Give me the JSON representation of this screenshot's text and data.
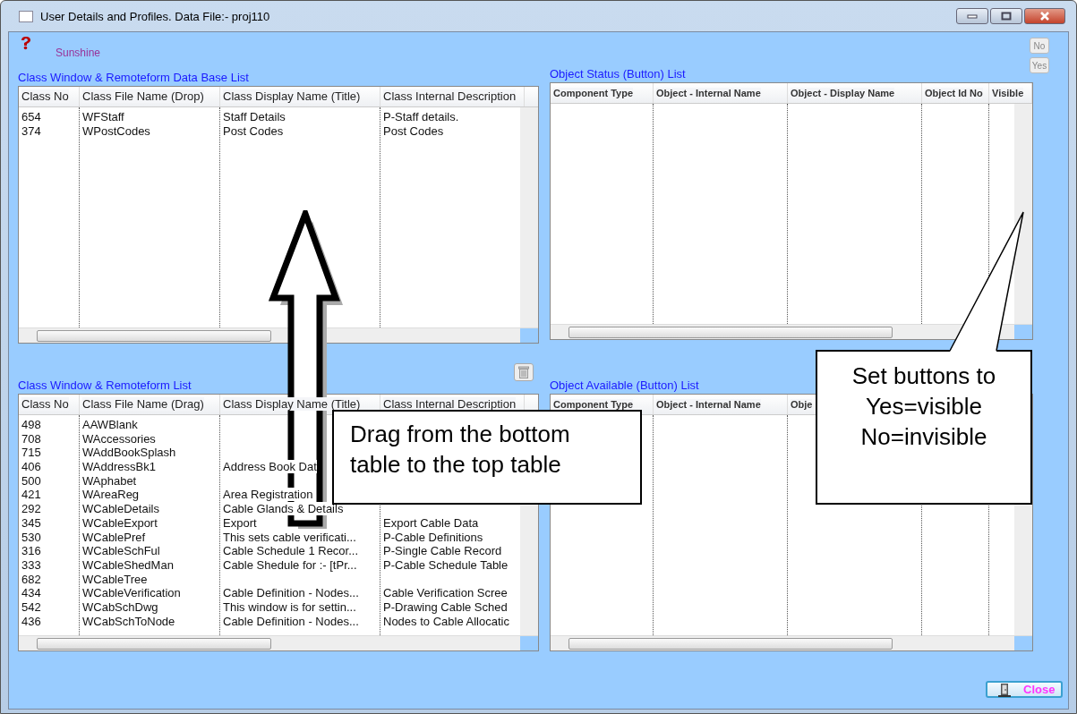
{
  "window": {
    "title": "User Details and Profiles. Data File:- proj110"
  },
  "user": "Sunshine",
  "buttons": [
    {
      "label": "No"
    },
    {
      "label": "Yes"
    }
  ],
  "class_db_list": {
    "title": "Class Window & Remoteform Data Base List",
    "columns": [
      "Class No",
      "Class File Name (Drop)",
      "Class Display Name (Title)",
      "Class Internal Description"
    ],
    "rows": [
      [
        "654",
        "WFStaff",
        "Staff Details",
        "P-Staff details."
      ],
      [
        "374",
        "WPostCodes",
        "Post Codes",
        "Post Codes"
      ]
    ]
  },
  "object_status_list": {
    "title": "Object Status (Button) List",
    "columns": [
      "Component Type",
      "Object - Internal Name",
      "Object - Display Name",
      "Object Id No",
      "Visible"
    ]
  },
  "class_list": {
    "title": "Class Window & Remoteform List",
    "columns": [
      "Class No",
      "Class File Name (Drag)",
      "Class Display Name (Title)",
      "Class Internal Description"
    ],
    "rows": [
      [
        "498",
        "AAWBlank",
        "",
        ""
      ],
      [
        "708",
        "WAccessories",
        "",
        ""
      ],
      [
        "715",
        "WAddBookSplash",
        "",
        ""
      ],
      [
        "406",
        "WAddressBk1",
        "Address Book Dat",
        ""
      ],
      [
        "500",
        "WAphabet",
        "",
        ""
      ],
      [
        "421",
        "WAreaReg",
        "Area Registration",
        ""
      ],
      [
        "292",
        "WCableDetails",
        "Cable Glands & Details",
        ""
      ],
      [
        "345",
        "WCableExport",
        "Export",
        "Export Cable Data"
      ],
      [
        "530",
        "WCablePref",
        "This sets cable verificati...",
        "P-Cable Definitions"
      ],
      [
        "316",
        "WCableSchFul",
        "Cable Schedule 1 Recor...",
        "P-Single Cable Record"
      ],
      [
        "333",
        "WCableShedMan",
        "Cable Shedule  for :- [tPr...",
        "P-Cable Schedule Table"
      ],
      [
        "682",
        "WCableTree",
        "",
        ""
      ],
      [
        "434",
        "WCableVerification",
        "Cable Definition - Nodes...",
        "Cable Verification Scree"
      ],
      [
        "542",
        "WCabSchDwg",
        "This window is for settin...",
        "P-Drawing Cable Sched"
      ],
      [
        "436",
        "WCabSchToNode",
        "Cable Definition - Nodes...",
        "Nodes to Cable Allocatic"
      ]
    ]
  },
  "object_available_list": {
    "title": "Object Available (Button) List",
    "columns": [
      "Component Type",
      "Object - Internal Name",
      "Obje"
    ]
  },
  "close_button": {
    "label": "Close"
  },
  "annotations": [
    {
      "kind": "arrow"
    },
    {
      "kind": "callout",
      "text": "Drag from the bottom table to the top table"
    },
    {
      "kind": "pointer_callout",
      "text": "Set buttons to Yes=visible No=invisible"
    }
  ]
}
